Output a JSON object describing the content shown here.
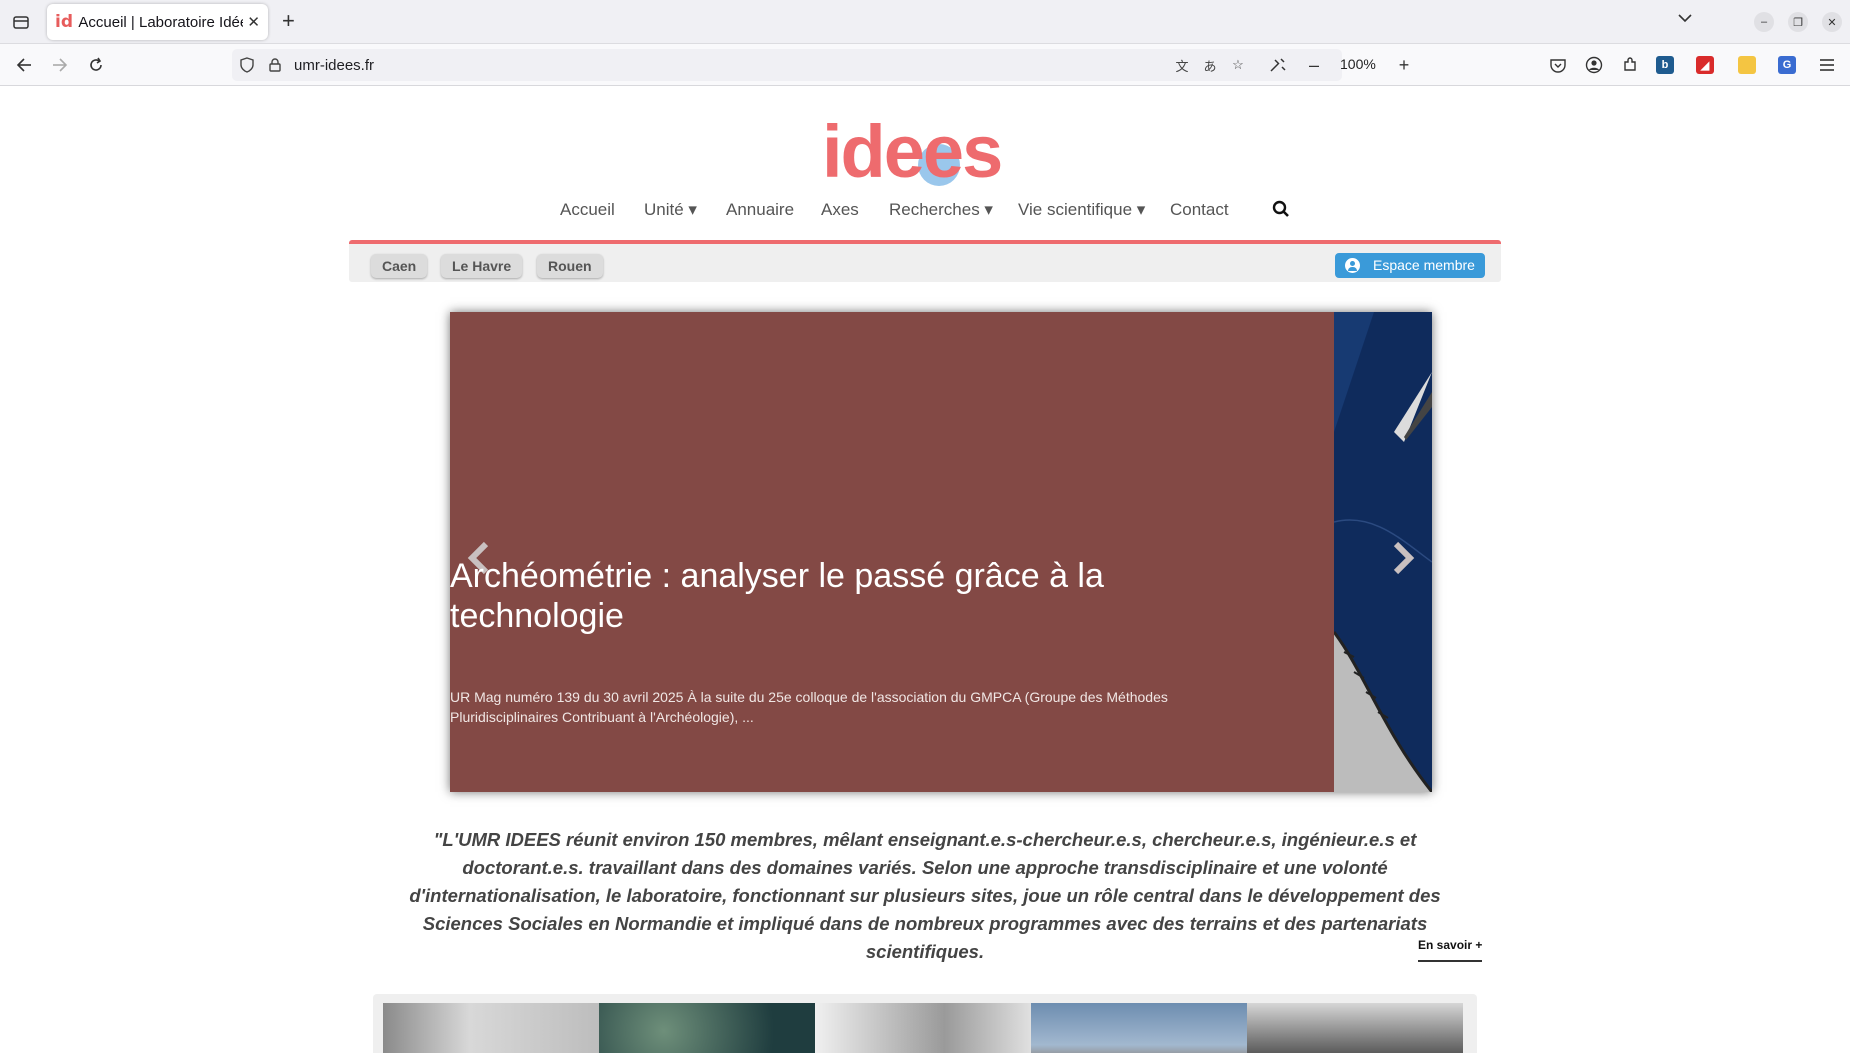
{
  "browser": {
    "tab_title": "Accueil | Laboratoire Idées",
    "tab_favicon": "id",
    "url": "umr-idees.fr",
    "zoom": "100%",
    "icons": [
      "tab-list-icon",
      "close-tab-icon",
      "new-tab-icon",
      "tab-overflow-icon",
      "minimize-icon",
      "restore-icon",
      "close-window-icon",
      "back-icon",
      "forward-icon",
      "reload-icon",
      "shield-icon",
      "lock-icon",
      "translate-icon",
      "page-translate-icon",
      "bookmark-star-icon",
      "tools-icon",
      "zoom-out-icon",
      "zoom-in-icon",
      "pocket-icon",
      "account-icon",
      "extensions-icon",
      "menu-icon"
    ]
  },
  "site": {
    "logo": "idees",
    "nav": [
      {
        "label": "Accueil"
      },
      {
        "label": "Unité ▾"
      },
      {
        "label": "Annuaire"
      },
      {
        "label": "Axes"
      },
      {
        "label": "Recherches ▾"
      },
      {
        "label": "Vie scientifique ▾"
      },
      {
        "label": "Contact"
      }
    ],
    "cities": [
      "Caen",
      "Le Havre",
      "Rouen"
    ],
    "member_button": "Espace membre"
  },
  "slider": {
    "title": "Archéométrie : analyser le passé grâce à la technologie",
    "text": "UR Mag numéro 139 du 30 avril 2025 À la suite du 25e colloque de l'association du GMPCA (Groupe des Méthodes Pluridisciplinaires Contribuant à l'Archéologie), ...",
    "bg_color": "#834945"
  },
  "intro": {
    "text": "\"L'UMR IDEES réunit environ 150 membres, mêlant enseignant.e.s-chercheur.e.s, chercheur.e.s, ingénieur.e.s et doctorant.e.s. travaillant dans des domaines variés. Selon une approche transdisciplinaire et une volonté d'internationalisation, le laboratoire, fonctionnant sur plusieurs sites, joue un rôle central dans le développement des Sciences Sociales en Normandie et impliqué dans de nombreux programmes avec des terrains et des partenariats scientifiques.",
    "more": "En savoir +"
  },
  "colors": {
    "brand": "#ee6b6e",
    "member_blue": "#3a9ad9"
  }
}
